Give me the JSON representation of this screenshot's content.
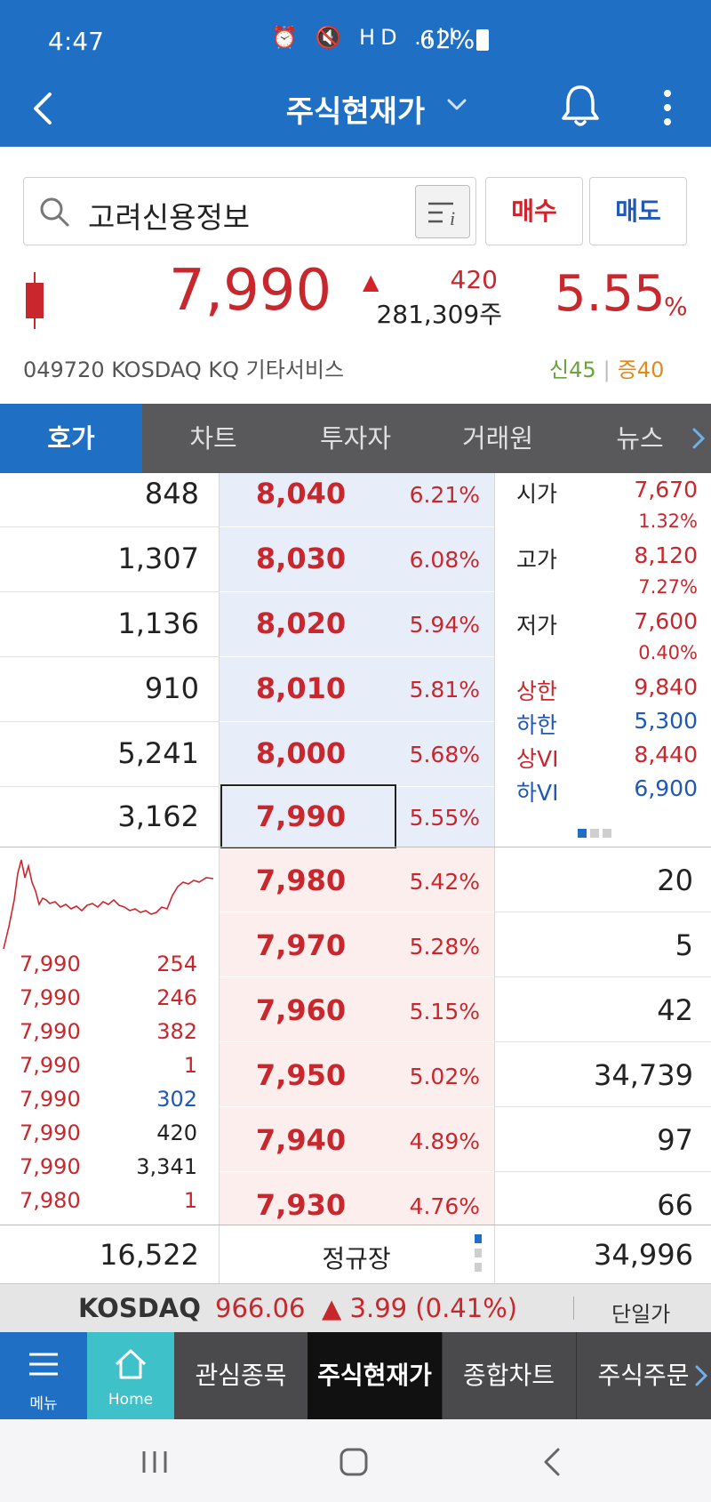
{
  "status_bar": {
    "time": "4:47",
    "icons": "⏰ 🔇 HD .ıll",
    "battery": "62%"
  },
  "app_bar": {
    "title": "주식현재가"
  },
  "search": {
    "value": "고려신용정보"
  },
  "actions": {
    "buy_label": "매수",
    "sell_label": "매도"
  },
  "quote": {
    "price": "7,990",
    "change": "420",
    "volume": "281,309주",
    "change_pct": "5.55",
    "pct_sign": "%",
    "code_line": "049720  KOSDAQ  KQ 기타서비스",
    "credit_label": "신45",
    "margin_label": "증40",
    "colors": {
      "up": "#c8282d",
      "down": "#1f58b8",
      "brand": "#1f6fc5"
    }
  },
  "tabs": [
    {
      "label": "호가",
      "active": true
    },
    {
      "label": "차트",
      "active": false
    },
    {
      "label": "투자자",
      "active": false
    },
    {
      "label": "거래원",
      "active": false
    },
    {
      "label": "뉴스",
      "active": false
    }
  ],
  "asks": [
    {
      "qty": "848",
      "price": "8,040",
      "pct": "6.21%"
    },
    {
      "qty": "1,307",
      "price": "8,030",
      "pct": "6.08%"
    },
    {
      "qty": "1,136",
      "price": "8,020",
      "pct": "5.94%"
    },
    {
      "qty": "910",
      "price": "8,010",
      "pct": "5.81%"
    },
    {
      "qty": "5,241",
      "price": "8,000",
      "pct": "5.68%"
    },
    {
      "qty": "3,162",
      "price": "7,990",
      "pct": "5.55%"
    }
  ],
  "bids": [
    {
      "qty": "20",
      "price": "7,980",
      "pct": "5.42%"
    },
    {
      "qty": "5",
      "price": "7,970",
      "pct": "5.28%"
    },
    {
      "qty": "42",
      "price": "7,960",
      "pct": "5.15%"
    },
    {
      "qty": "34,739",
      "price": "7,950",
      "pct": "5.02%"
    },
    {
      "qty": "97",
      "price": "7,940",
      "pct": "4.89%"
    },
    {
      "qty": "66",
      "price": "7,930",
      "pct": "4.76%"
    }
  ],
  "info": {
    "open": {
      "label": "시가",
      "value": "7,670",
      "pct": "1.32%"
    },
    "high": {
      "label": "고가",
      "value": "8,120",
      "pct": "7.27%"
    },
    "low": {
      "label": "저가",
      "value": "7,600",
      "pct": "0.40%"
    },
    "upper": {
      "label": "상한",
      "value": "9,840"
    },
    "lower": {
      "label": "하한",
      "value": "5,300"
    },
    "vi_up": {
      "label": "상VI",
      "value": "8,440"
    },
    "vi_down": {
      "label": "하VI",
      "value": "6,900"
    },
    "page_indicator": {
      "pages": 3,
      "current": 1
    }
  },
  "trades": [
    {
      "price": "7,990",
      "qty": "254",
      "side": "buy"
    },
    {
      "price": "7,990",
      "qty": "246",
      "side": "buy"
    },
    {
      "price": "7,990",
      "qty": "382",
      "side": "buy"
    },
    {
      "price": "7,990",
      "qty": "1",
      "side": "buy"
    },
    {
      "price": "7,990",
      "qty": "302",
      "side": "sell"
    },
    {
      "price": "7,990",
      "qty": "420",
      "side": "neutral"
    },
    {
      "price": "7,990",
      "qty": "3,341",
      "side": "neutral"
    },
    {
      "price": "7,980",
      "qty": "1",
      "side": "buy"
    }
  ],
  "summary": {
    "total_ask": "16,522",
    "session": "정규장",
    "total_bid": "34,996"
  },
  "index_ticker": {
    "name": "KOSDAQ",
    "value": "966.06",
    "change": "▲ 3.99 (0.41%)",
    "price_mode": "단일가"
  },
  "bottom_nav": {
    "menu": "메뉴",
    "home": "Home",
    "items": [
      "관심종목",
      "주식현재가",
      "종합차트",
      "주식주문"
    ]
  }
}
